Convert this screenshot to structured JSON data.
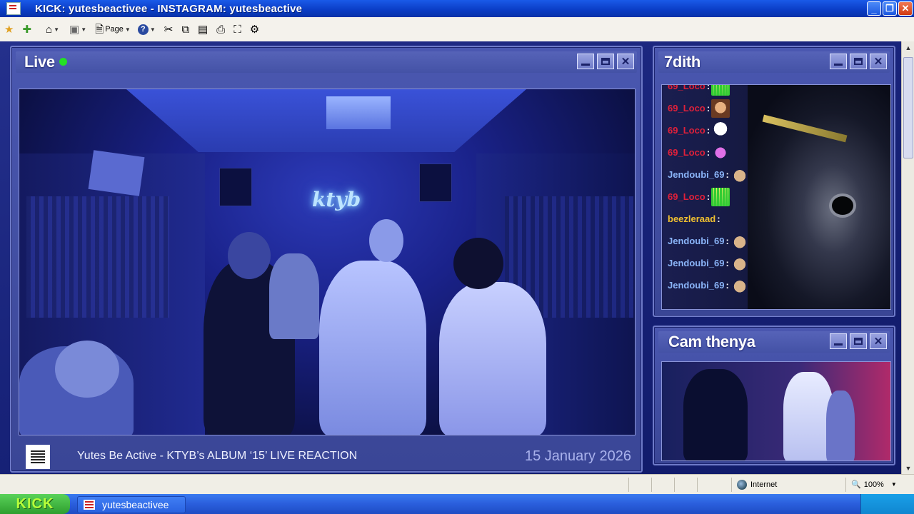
{
  "window": {
    "title": "KICK: yutesbeactivee -  INSTAGRAM: yutesbeactive"
  },
  "toolbar": {
    "items": [
      {
        "name": "favorites-star-icon",
        "glyph": "★"
      },
      {
        "name": "add-favorite-icon",
        "glyph": "✚"
      },
      {
        "name": "home-icon",
        "glyph": "⌂"
      },
      {
        "name": "feeds-icon",
        "glyph": "▣"
      },
      {
        "name": "page-menu-icon",
        "glyph": "🗎"
      },
      {
        "name": "help-icon",
        "glyph": "?"
      },
      {
        "name": "cut-icon",
        "glyph": "✂"
      },
      {
        "name": "copy-icon",
        "glyph": "⧉"
      },
      {
        "name": "paste-icon",
        "glyph": "📋"
      },
      {
        "name": "print-icon",
        "glyph": "⎙"
      },
      {
        "name": "fullscreen-icon",
        "glyph": "⛶"
      },
      {
        "name": "research-icon",
        "glyph": "⚙"
      }
    ],
    "page_label": "Page"
  },
  "live_panel": {
    "title": "Live",
    "status_color": "#24e024",
    "neon_sign": "ktyb",
    "caption": "Yutes Be Active - KTYB’s ALBUM ‘15’ LIVE REACTION",
    "date": "15 January 2026"
  },
  "chat_panel": {
    "title": "7dith",
    "messages": [
      {
        "user": "69_Loco",
        "sep": ":",
        "color": "#e0203a",
        "emote": "bars"
      },
      {
        "user": "69_Loco",
        "sep": ":",
        "color": "#e0203a",
        "emote": "face"
      },
      {
        "user": "69_Loco",
        "sep": ":",
        "color": "#e0203a",
        "emote": "ghost"
      },
      {
        "user": "69_Loco",
        "sep": ":",
        "color": "#e0203a",
        "emote": "hand"
      },
      {
        "user": "Jendoubi_69",
        "sep": ":",
        "color": "#8ab4f8",
        "emote": "cat"
      },
      {
        "user": "69_Loco",
        "sep": ":",
        "color": "#e0203a",
        "emote": "bars"
      },
      {
        "user": "beezleraad",
        "sep": ":",
        "color": "#f0c030",
        "emote": ""
      },
      {
        "user": "Jendoubi_69",
        "sep": ":",
        "color": "#8ab4f8",
        "emote": "cat"
      },
      {
        "user": "Jendoubi_69",
        "sep": ":",
        "color": "#8ab4f8",
        "emote": "cat"
      },
      {
        "user": "Jendoubi_69",
        "sep": ":",
        "color": "#8ab4f8",
        "emote": "cat"
      }
    ]
  },
  "cam_panel": {
    "title": "Cam thenya"
  },
  "statusbar": {
    "zone": "Internet",
    "zoom": "100%"
  },
  "taskbar": {
    "start_label": "KICK",
    "task_label": "yutesbeactivee"
  }
}
